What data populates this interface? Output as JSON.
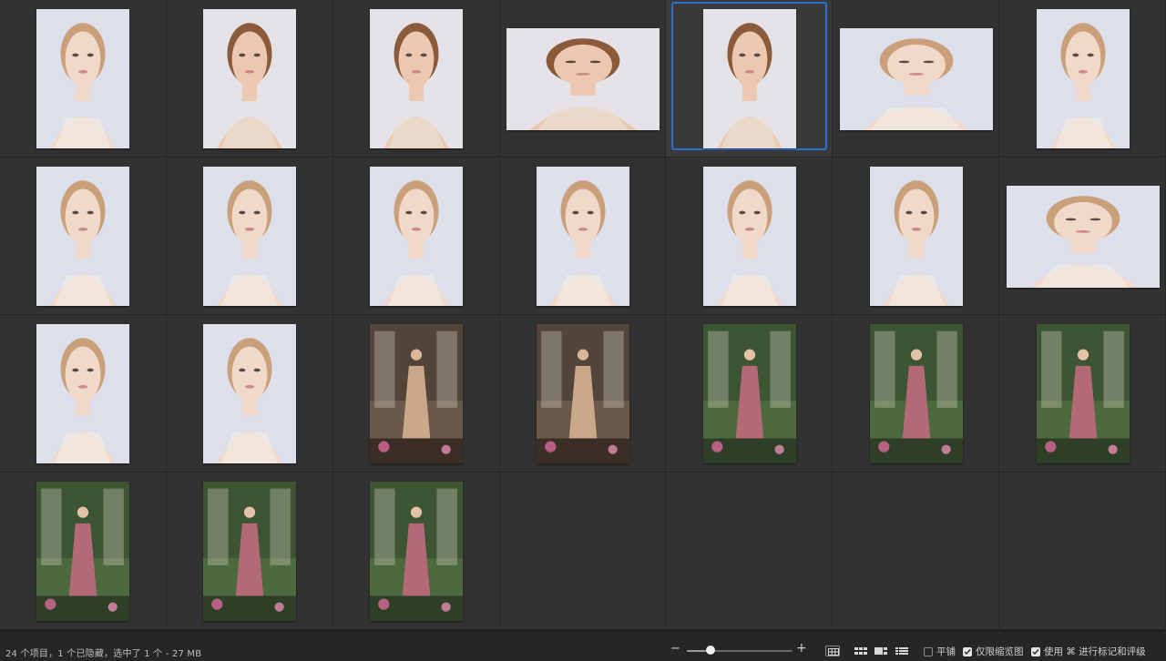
{
  "window": {
    "background": "#2e2e2e",
    "selection_color": "#2f6fd1"
  },
  "grid": {
    "rows": 4,
    "columns": 7,
    "selected_index": 4,
    "items": [
      {
        "name": "portrait-hands-face-blonde",
        "orientation": "portrait",
        "tone": "studio-light"
      },
      {
        "name": "portrait-long-hair-1",
        "orientation": "portrait",
        "tone": "studio-warm"
      },
      {
        "name": "portrait-long-hair-2",
        "orientation": "portrait",
        "tone": "studio-warm"
      },
      {
        "name": "closeup-hand-in-hair",
        "orientation": "landscape",
        "tone": "studio-warm"
      },
      {
        "name": "portrait-long-hair-3",
        "orientation": "portrait",
        "tone": "studio-warm"
      },
      {
        "name": "ponytail-with-spray",
        "orientation": "landscape",
        "tone": "studio-light"
      },
      {
        "name": "portrait-shoulder",
        "orientation": "portrait",
        "tone": "studio-light"
      },
      {
        "name": "portrait-bun-1",
        "orientation": "portrait",
        "tone": "studio-light"
      },
      {
        "name": "portrait-eyes-closed",
        "orientation": "portrait",
        "tone": "studio-light"
      },
      {
        "name": "portrait-profile-down",
        "orientation": "portrait",
        "tone": "studio-light"
      },
      {
        "name": "portrait-hand-on-cheek",
        "orientation": "portrait",
        "tone": "studio-light"
      },
      {
        "name": "portrait-smile",
        "orientation": "portrait",
        "tone": "studio-light"
      },
      {
        "name": "portrait-hands-neck",
        "orientation": "portrait",
        "tone": "studio-light"
      },
      {
        "name": "two-models-closeup",
        "orientation": "landscape",
        "tone": "studio-light"
      },
      {
        "name": "portrait-blonde-hand-chin",
        "orientation": "portrait",
        "tone": "studio-light"
      },
      {
        "name": "blonde-eye-patch",
        "orientation": "portrait",
        "tone": "studio-light"
      },
      {
        "name": "gown-by-windows",
        "orientation": "portrait",
        "tone": "interior"
      },
      {
        "name": "two-models-windows",
        "orientation": "portrait",
        "tone": "interior"
      },
      {
        "name": "dress-in-garden-1",
        "orientation": "portrait",
        "tone": "garden"
      },
      {
        "name": "dress-in-garden-2",
        "orientation": "portrait",
        "tone": "garden"
      },
      {
        "name": "three-gowns-garden",
        "orientation": "portrait",
        "tone": "garden"
      },
      {
        "name": "three-models-flowers",
        "orientation": "portrait",
        "tone": "garden"
      },
      {
        "name": "blonde-red-dress-garden",
        "orientation": "portrait",
        "tone": "garden"
      },
      {
        "name": "navy-lace-gown-garden",
        "orientation": "portrait",
        "tone": "garden"
      }
    ]
  },
  "statusbar": {
    "status_text": "24 个项目，1 个已隐藏，选中了 1 个 - 27 MB",
    "zoom_minus": "−",
    "zoom_plus": "+",
    "zoom_level": 0.22,
    "options": [
      {
        "label": "平铺",
        "checked": false
      },
      {
        "label": "仅限缩览图",
        "checked": true
      },
      {
        "label": "使用 ⌘ 进行标记和评级",
        "checked": true
      }
    ]
  }
}
